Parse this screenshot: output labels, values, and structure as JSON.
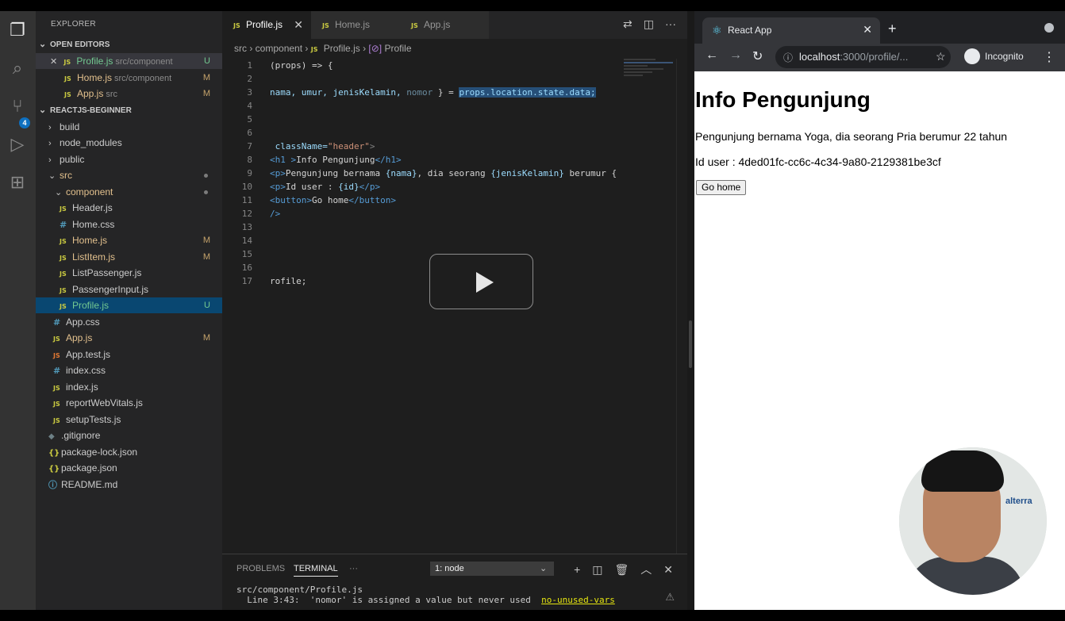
{
  "vscode": {
    "explorer_title": "EXPLORER",
    "open_editors": {
      "header": "OPEN EDITORS",
      "items": [
        {
          "close": "✕",
          "icon": "JS",
          "name": "Profile.js",
          "path": "src/component",
          "status": "U"
        },
        {
          "icon": "JS",
          "name": "Home.js",
          "path": "src/component",
          "status": "M"
        },
        {
          "icon": "JS",
          "name": "App.js",
          "path": "src",
          "status": "M"
        }
      ]
    },
    "project": {
      "header": "REACTJS-BEGINNER",
      "items": [
        {
          "kind": "folder",
          "name": "build"
        },
        {
          "kind": "folder",
          "name": "node_modules"
        },
        {
          "kind": "folder",
          "name": "public"
        },
        {
          "kind": "folder-open",
          "name": "src"
        },
        {
          "kind": "folder-open",
          "name": "component"
        },
        {
          "icon": "JS",
          "name": "Header.js"
        },
        {
          "icon": "#",
          "name": "Home.css"
        },
        {
          "icon": "JS",
          "name": "Home.js",
          "status": "M"
        },
        {
          "icon": "JS",
          "name": "ListItem.js",
          "status": "M"
        },
        {
          "icon": "JS",
          "name": "ListPassenger.js"
        },
        {
          "icon": "JS",
          "name": "PassengerInput.js"
        },
        {
          "icon": "JS",
          "name": "Profile.js",
          "status": "U"
        },
        {
          "icon": "#",
          "name": "App.css"
        },
        {
          "icon": "JS",
          "name": "App.js",
          "status": "M"
        },
        {
          "icon": "JS",
          "name": "App.test.js"
        },
        {
          "icon": "#",
          "name": "index.css"
        },
        {
          "icon": "JS",
          "name": "index.js"
        },
        {
          "icon": "JS",
          "name": "reportWebVitals.js"
        },
        {
          "icon": "JS",
          "name": "setupTests.js"
        },
        {
          "icon": "◆",
          "name": ".gitignore"
        },
        {
          "icon": "{}",
          "name": "package-lock.json"
        },
        {
          "icon": "{}",
          "name": "package.json"
        },
        {
          "icon": "ⓘ",
          "name": "README.md"
        }
      ]
    },
    "tabs": [
      {
        "icon": "JS",
        "name": "Profile.js",
        "close": "✕"
      },
      {
        "icon": "JS",
        "name": "Home.js"
      },
      {
        "icon": "JS",
        "name": "App.js"
      }
    ],
    "breadcrumb": {
      "part1": "src",
      "part2": "component",
      "part3": "Profile.js",
      "part4": "Profile"
    },
    "code_lines": [
      {
        "n": "1",
        "text": "(props) => {"
      },
      {
        "n": "2",
        "text": ""
      },
      {
        "n": "3",
        "a": "nama, umur, jenisKelamin, ",
        "b": "nomor",
        "c": " } = ",
        "d": "props.location.state.data;"
      },
      {
        "n": "4",
        "text": ""
      },
      {
        "n": "5",
        "text": ""
      },
      {
        "n": "6",
        "text": ""
      },
      {
        "n": "7",
        "a": " className=",
        "b": "\"header\"",
        "c": ">"
      },
      {
        "n": "8",
        "a": "<h1 >",
        "b": "Info Pengunjung",
        "c": "</h1>"
      },
      {
        "n": "9",
        "a": "<p>",
        "b": "Pengunjung bernama ",
        "c": "{nama}",
        "d": ", dia seorang ",
        "e": "{jenisKelamin}",
        "f": " berumur {"
      },
      {
        "n": "10",
        "a": "<p>",
        "b": "Id user : ",
        "c": "{id}",
        "d": "</p>"
      },
      {
        "n": "11",
        "a": "<button>",
        "b": "Go home",
        "c": "</button>"
      },
      {
        "n": "12",
        "text": "/>"
      },
      {
        "n": "13",
        "text": ""
      },
      {
        "n": "14",
        "text": ""
      },
      {
        "n": "15",
        "text": ""
      },
      {
        "n": "16",
        "text": ""
      },
      {
        "n": "17",
        "text": "rofile;"
      }
    ],
    "panel": {
      "problems": "PROBLEMS",
      "terminal": "TERMINAL",
      "more": "···",
      "terminal_select": "1: node",
      "term_line1": "src/component/Profile.js",
      "term_line2": "  Line 3:43:  'nomor' is assigned a value but never used  ",
      "term_rule": "no-unused-vars"
    },
    "scm_badge": "4"
  },
  "chrome": {
    "tab_title": "React App",
    "url_host": "localhost",
    "url_path": ":3000/profile/...",
    "incognito": "Incognito",
    "page": {
      "heading": "Info Pengunjung",
      "line1": "Pengunjung bernama Yoga, dia seorang Pria berumur 22 tahun",
      "line2": "Id user : 4ded01fc-cc6c-4c34-9a80-2129381be3cf",
      "button": "Go home"
    }
  },
  "webcam": {
    "logo": "alterra"
  }
}
